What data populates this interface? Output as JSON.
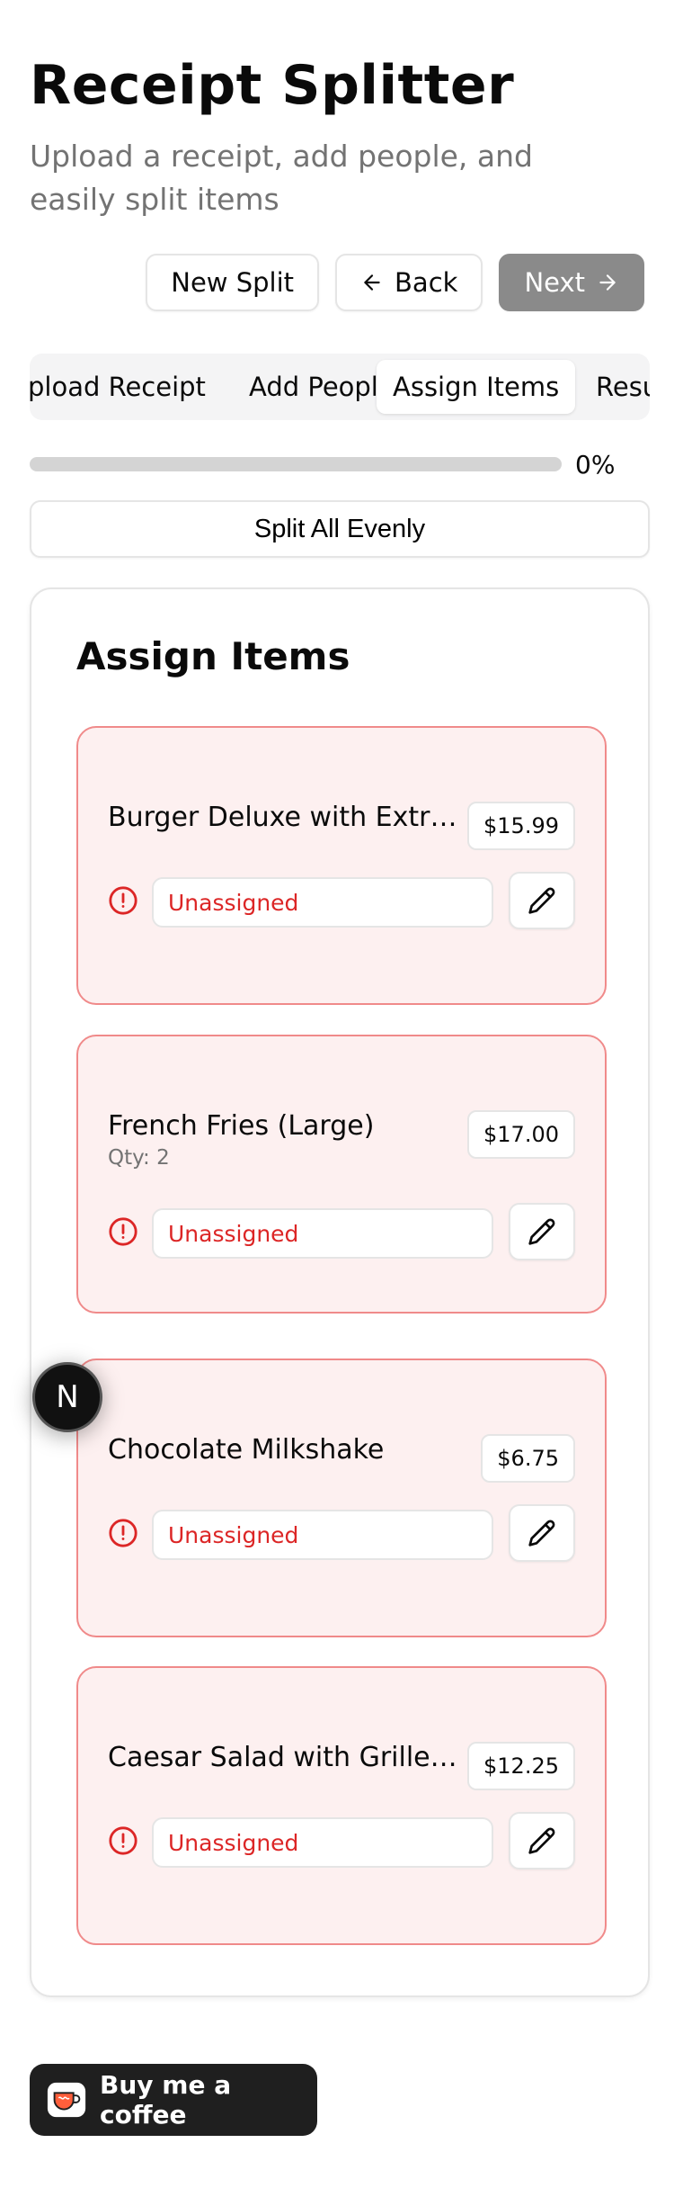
{
  "header": {
    "title": "Receipt Splitter",
    "subtitle": "Upload a receipt, add people, and easily split items"
  },
  "actions": {
    "new_split": "New Split",
    "back": "Back",
    "next": "Next"
  },
  "tabs": [
    {
      "label": "Upload Receipt",
      "visible_text": "pload Receipt"
    },
    {
      "label": "Add People"
    },
    {
      "label": "Assign Items",
      "active": true
    },
    {
      "label": "Results",
      "visible_text": "Resu"
    }
  ],
  "progress": {
    "value": 0,
    "label": "0%"
  },
  "split_evenly_label": "Split All Evenly",
  "assign_card": {
    "title": "Assign Items",
    "items": [
      {
        "name": "Burger Deluxe with Extra...",
        "price": "$15.99",
        "qty": "",
        "status": "Unassigned"
      },
      {
        "name": "French Fries (Large)",
        "price": "$17.00",
        "qty": "Qty: 2",
        "status": "Unassigned"
      },
      {
        "name": "Chocolate Milkshake",
        "price": "$6.75",
        "qty": "",
        "status": "Unassigned"
      },
      {
        "name": "Caesar Salad with Grilled...",
        "price": "$12.25",
        "qty": "",
        "status": "Unassigned"
      }
    ]
  },
  "dev_badge": "N",
  "coffee_button": "Buy me a coffee",
  "colors": {
    "danger": "#dc2626",
    "item_bg": "#fdf0f0",
    "item_border": "#f08a8a",
    "primary_disabled": "#8a8a8a",
    "dark": "#1f1f1f"
  },
  "icons": {
    "back": "arrow-left-icon",
    "next": "arrow-right-icon",
    "status": "alert-circle-icon",
    "edit": "pencil-icon",
    "coffee": "coffee-cup-icon"
  }
}
